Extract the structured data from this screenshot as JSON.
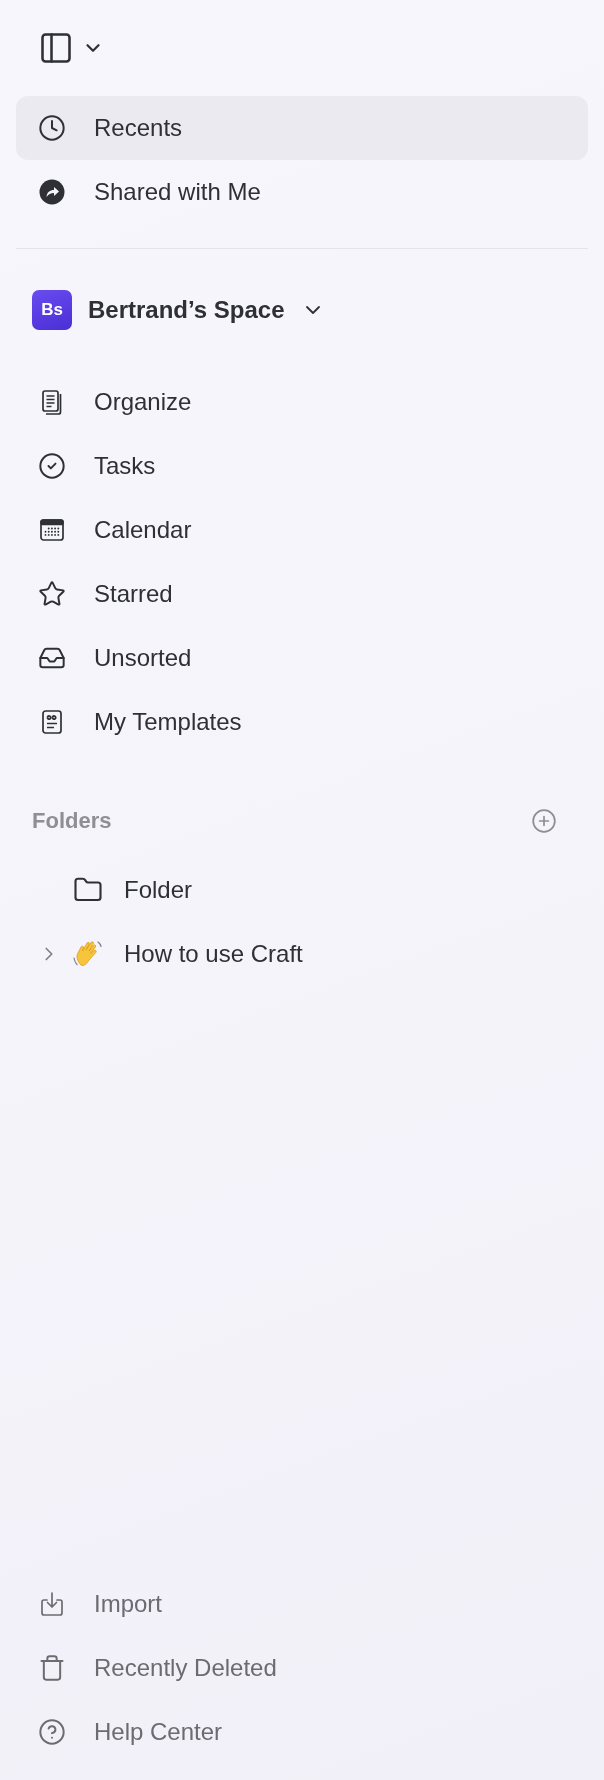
{
  "nav": [
    {
      "label": "Recents",
      "kind": "clock",
      "selected": true
    },
    {
      "label": "Shared with Me",
      "kind": "share",
      "selected": false
    }
  ],
  "space": {
    "initials": "Bs",
    "name": "Bertrand’s Space"
  },
  "space_items": [
    {
      "label": "Organize",
      "kind": "documents"
    },
    {
      "label": "Tasks",
      "kind": "check"
    },
    {
      "label": "Calendar",
      "kind": "calendar"
    },
    {
      "label": "Starred",
      "kind": "star"
    },
    {
      "label": "Unsorted",
      "kind": "inbox"
    },
    {
      "label": "My Templates",
      "kind": "template"
    }
  ],
  "folders": {
    "title": "Folders",
    "items": [
      {
        "label": "Folder",
        "kind": "folder",
        "expandable": false
      },
      {
        "label": "How to use Craft",
        "kind": "wave",
        "expandable": true,
        "expanded": false
      }
    ]
  },
  "footer": [
    {
      "label": "Import",
      "kind": "import"
    },
    {
      "label": "Recently Deleted",
      "kind": "trash"
    },
    {
      "label": "Help Center",
      "kind": "help"
    }
  ]
}
